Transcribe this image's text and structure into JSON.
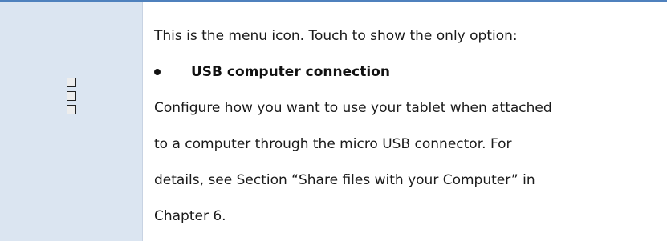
{
  "intro": "This is the menu icon. Touch to show the only option:",
  "option": {
    "label": "USB computer connection"
  },
  "description": {
    "lines": [
      "Configure how you want to use your tablet when attached",
      "to a computer through the micro USB connector. For",
      "details, see Section “Share files with your Computer” in",
      "Chapter 6."
    ]
  },
  "icon": {
    "name": "menu-icon"
  },
  "colors": {
    "accent_rule": "#4f81bd",
    "icon_cell_bg": "#dbe5f1"
  }
}
